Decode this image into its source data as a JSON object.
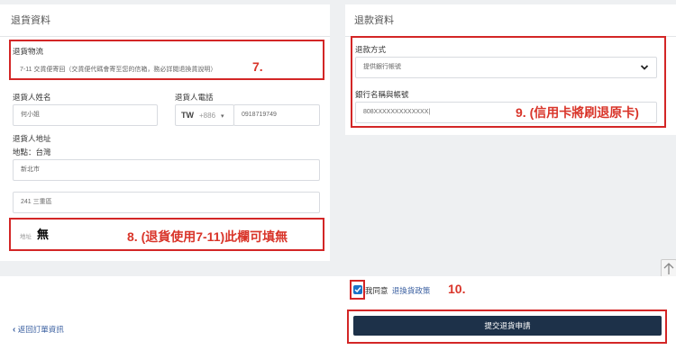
{
  "return_info": {
    "header": "退貨資料",
    "logistics_label": "退貨物流",
    "logistics_value": "7-11 交貨便寄回（交貨便代碼會寄至您的信箱，務必詳閱退換貨說明）",
    "name_label": "退貨人姓名",
    "name_value": "何小姐",
    "phone_label": "退貨人電話",
    "phone_country": "TW",
    "phone_code": "+886",
    "phone_caret": "▾",
    "phone_value": "0918719749",
    "address_label": "退貨人地址",
    "address_region": "地點：台灣",
    "city_value": "新北市",
    "district_value": "241 三重區",
    "address_placeholder": "地址",
    "address_value": "無"
  },
  "refund_info": {
    "header": "退款資料",
    "method_label": "退款方式",
    "method_value": "提供銀行帳號",
    "bank_label": "銀行名稱與帳號",
    "bank_value": "808XXXXXXXXXXXXX|"
  },
  "annotations": {
    "a7": "7.",
    "a8": "8. (退貨使用7-11)此欄可填無",
    "a9": "9. (信用卡將刷退原卡)",
    "a10": "10."
  },
  "footer": {
    "agree_text": "我同意",
    "policy_link": "退換貨政策",
    "submit_label": "提交退貨申請",
    "back_link": "返回訂單資訊",
    "back_chevron": "‹"
  },
  "colors": {
    "annotation_red": "#d32626",
    "submit_bg": "#1d3149",
    "checkbox_blue": "#1a73c8"
  }
}
